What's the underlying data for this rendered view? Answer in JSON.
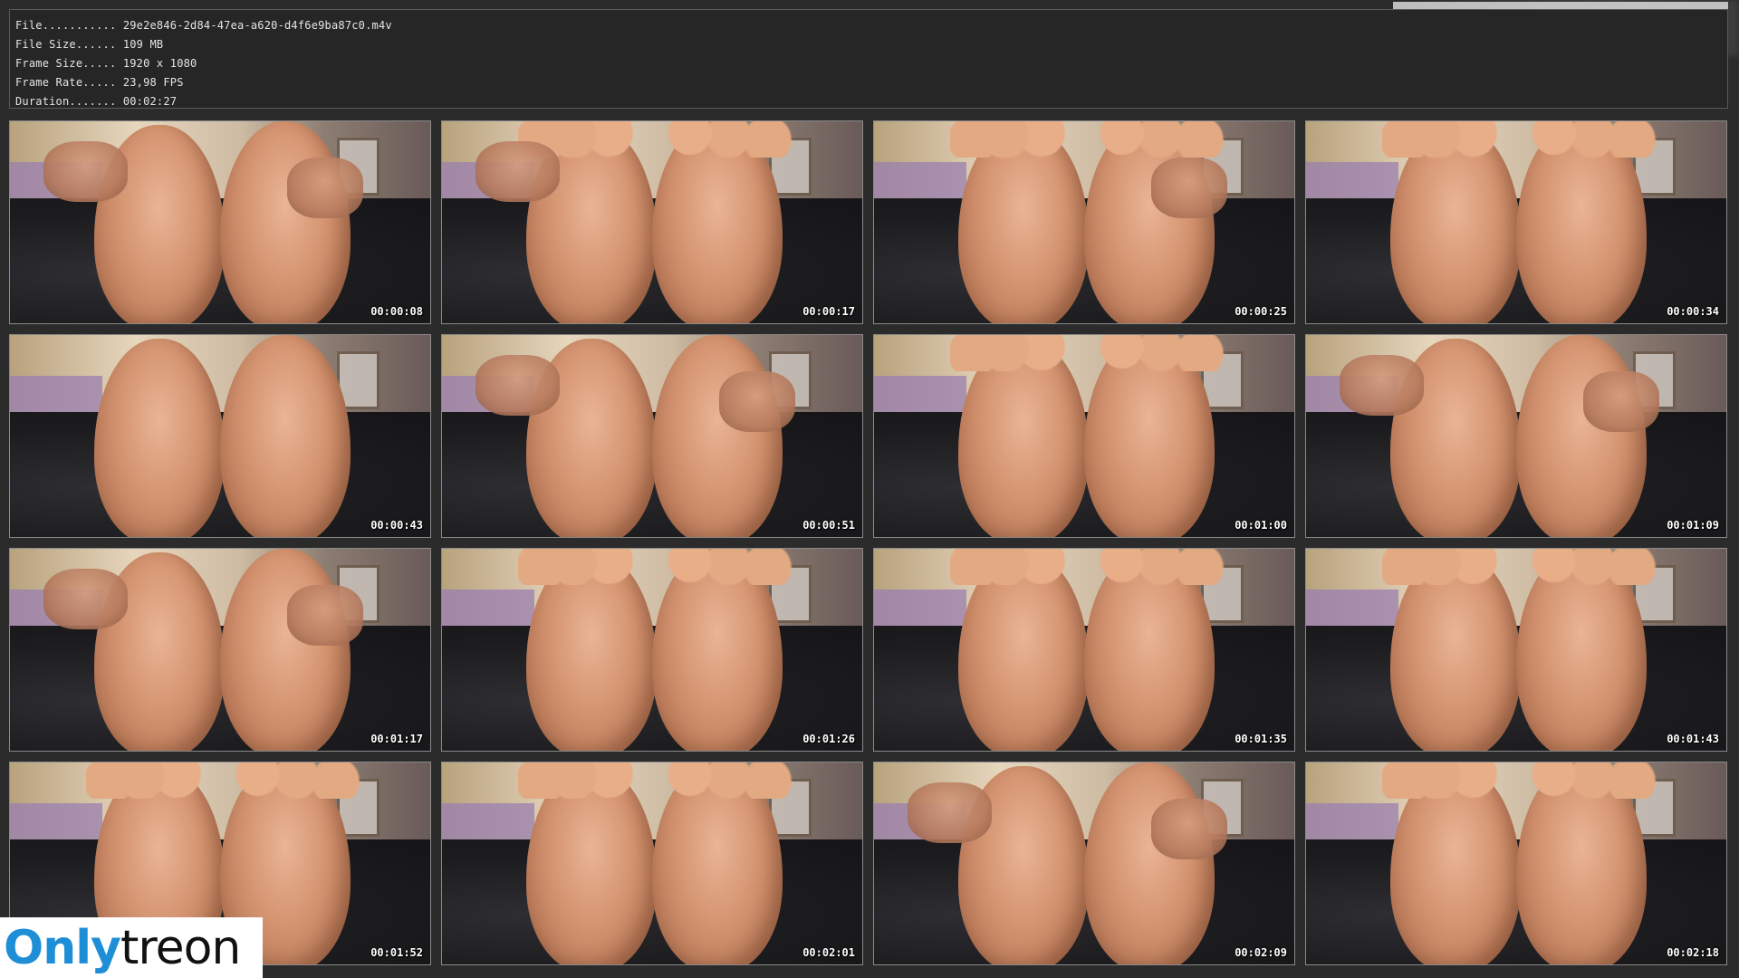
{
  "info": {
    "rows": [
      {
        "label": "File...........",
        "value": "29e2e846-2d84-47ea-a620-d4f6e9ba87c0.m4v"
      },
      {
        "label": "File Size......",
        "value": "109 MB"
      },
      {
        "label": "Frame Size.....",
        "value": "1920 x 1080"
      },
      {
        "label": "Frame Rate.....",
        "value": "23,98 FPS"
      },
      {
        "label": "Duration.......",
        "value": "00:02:27"
      }
    ]
  },
  "thumbnails": [
    {
      "time": "00:00:08"
    },
    {
      "time": "00:00:17"
    },
    {
      "time": "00:00:25"
    },
    {
      "time": "00:00:34"
    },
    {
      "time": "00:00:43"
    },
    {
      "time": "00:00:51"
    },
    {
      "time": "00:01:00"
    },
    {
      "time": "00:01:09"
    },
    {
      "time": "00:01:17"
    },
    {
      "time": "00:01:26"
    },
    {
      "time": "00:01:35"
    },
    {
      "time": "00:01:43"
    },
    {
      "time": "00:01:52"
    },
    {
      "time": "00:02:01"
    },
    {
      "time": "00:02:09"
    },
    {
      "time": "00:02:18"
    }
  ],
  "watermark": {
    "part_a": "Only",
    "part_b": "treon"
  }
}
